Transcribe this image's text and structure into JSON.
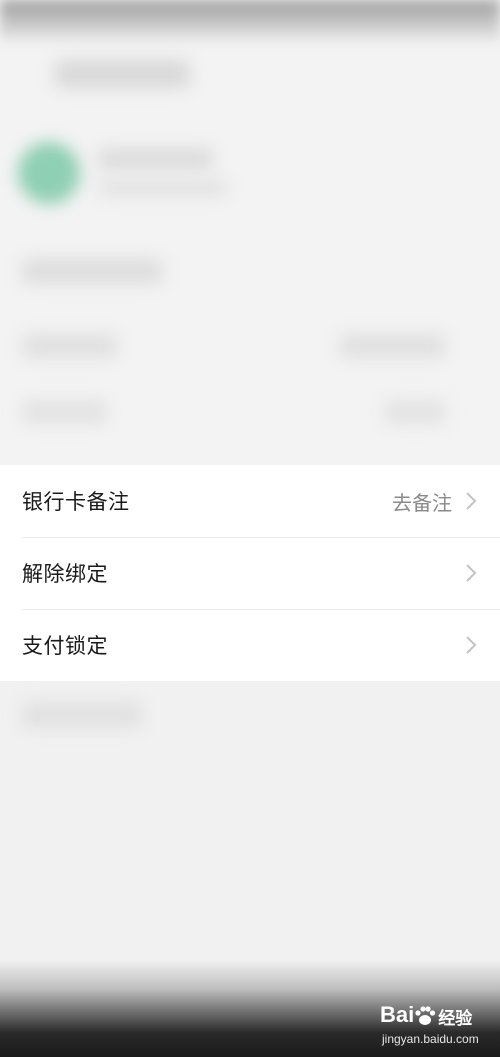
{
  "menu": {
    "items": [
      {
        "label": "银行卡备注",
        "value": "去备注"
      },
      {
        "label": "解除绑定",
        "value": ""
      },
      {
        "label": "支付锁定",
        "value": ""
      }
    ]
  },
  "watermark": {
    "brand": "Bai",
    "brand_suffix": "经验",
    "url": "jingyan.baidu.com"
  },
  "colors": {
    "avatar_accent": "#8fcfb3",
    "chevron": "#c4c4c4"
  }
}
